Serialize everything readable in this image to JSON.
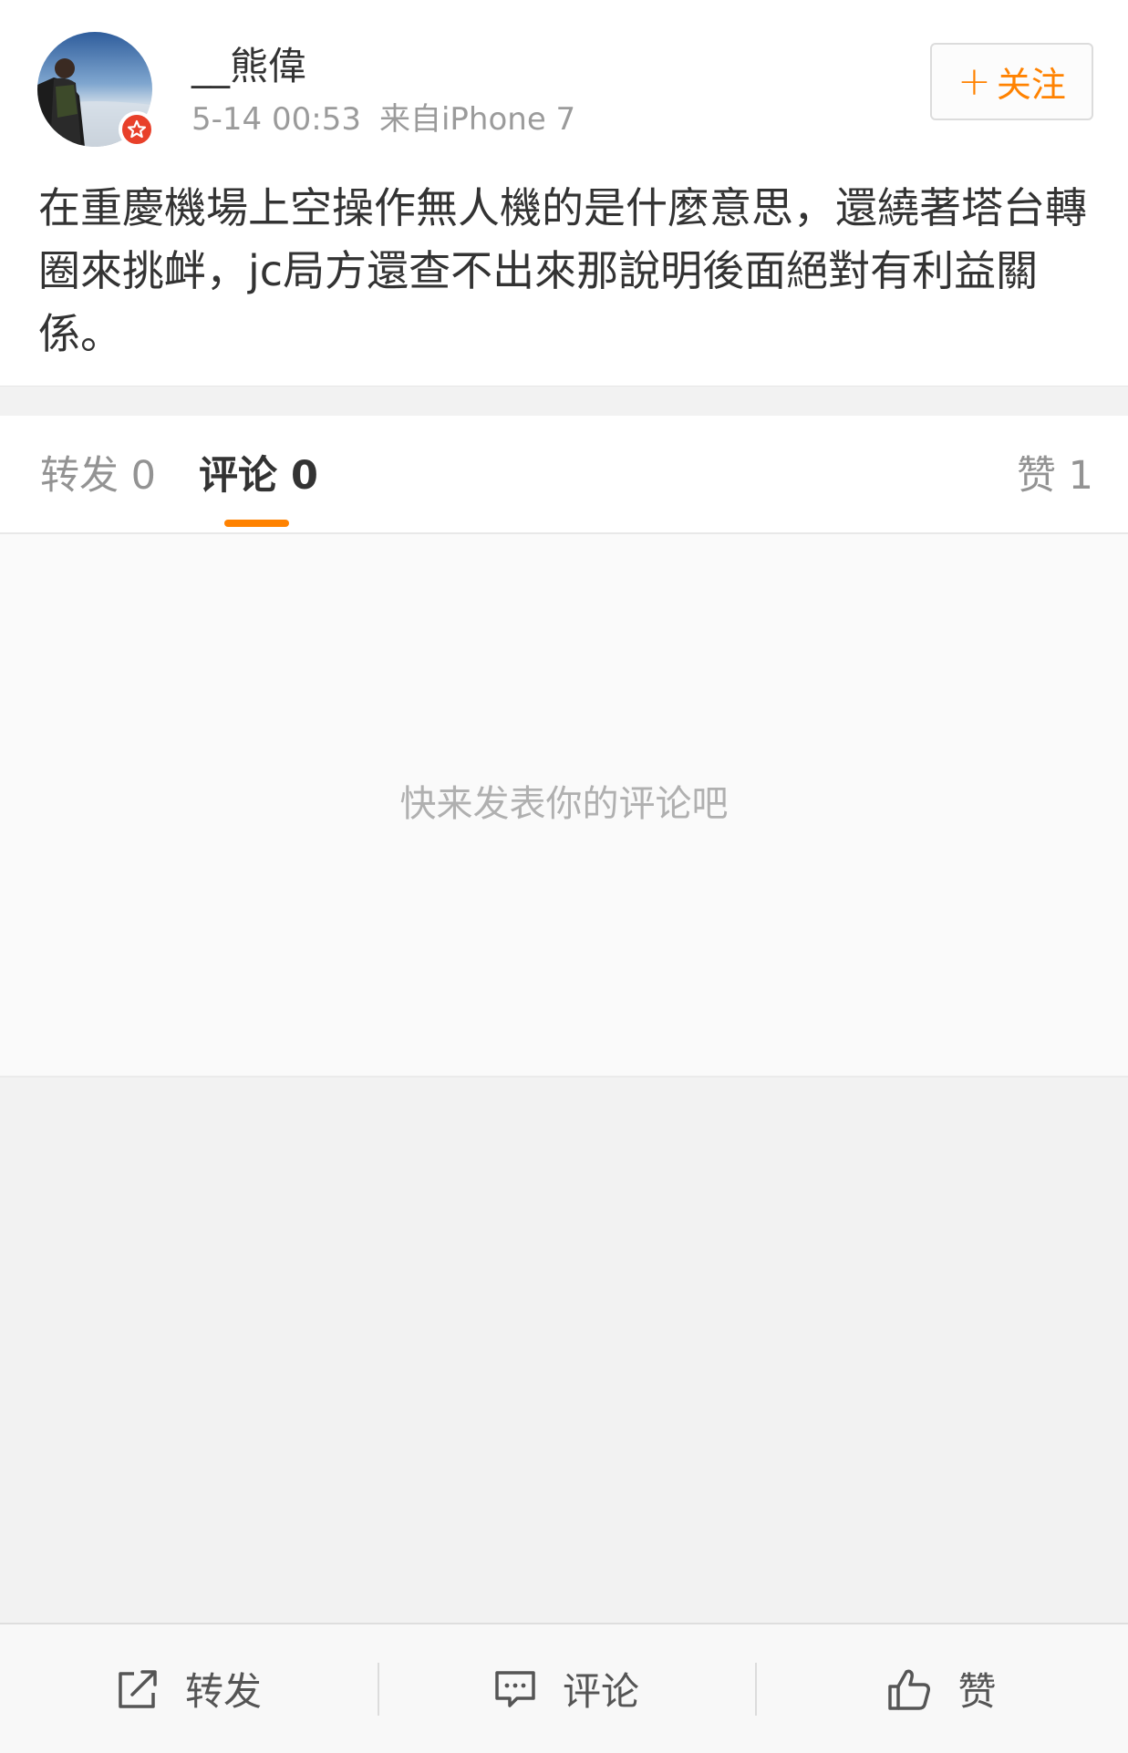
{
  "post": {
    "username": "__熊偉",
    "time": "5-14 00:53",
    "source": "来自iPhone 7",
    "follow_label": "关注",
    "follow_plus": "+",
    "text": "在重慶機場上空操作無人機的是什麼意思，還繞著塔台轉圈來挑衅，jc局方還查不出來那說明後面絕對有利益關係。",
    "badge_color": "#e8402a",
    "follow_color": "#ff8200"
  },
  "tabs": {
    "repost": "转发 0",
    "comment": "评论 0",
    "like": "赞 1",
    "active": "comment",
    "indicator_color": "#ff8200"
  },
  "comments": {
    "empty_text": "快来发表你的评论吧"
  },
  "toolbar": {
    "repost_label": "转发",
    "repost_icon": "share-icon",
    "comment_label": "评论",
    "comment_icon": "comment-bubble-icon",
    "like_label": "赞",
    "like_icon": "thumbs-up-icon"
  }
}
